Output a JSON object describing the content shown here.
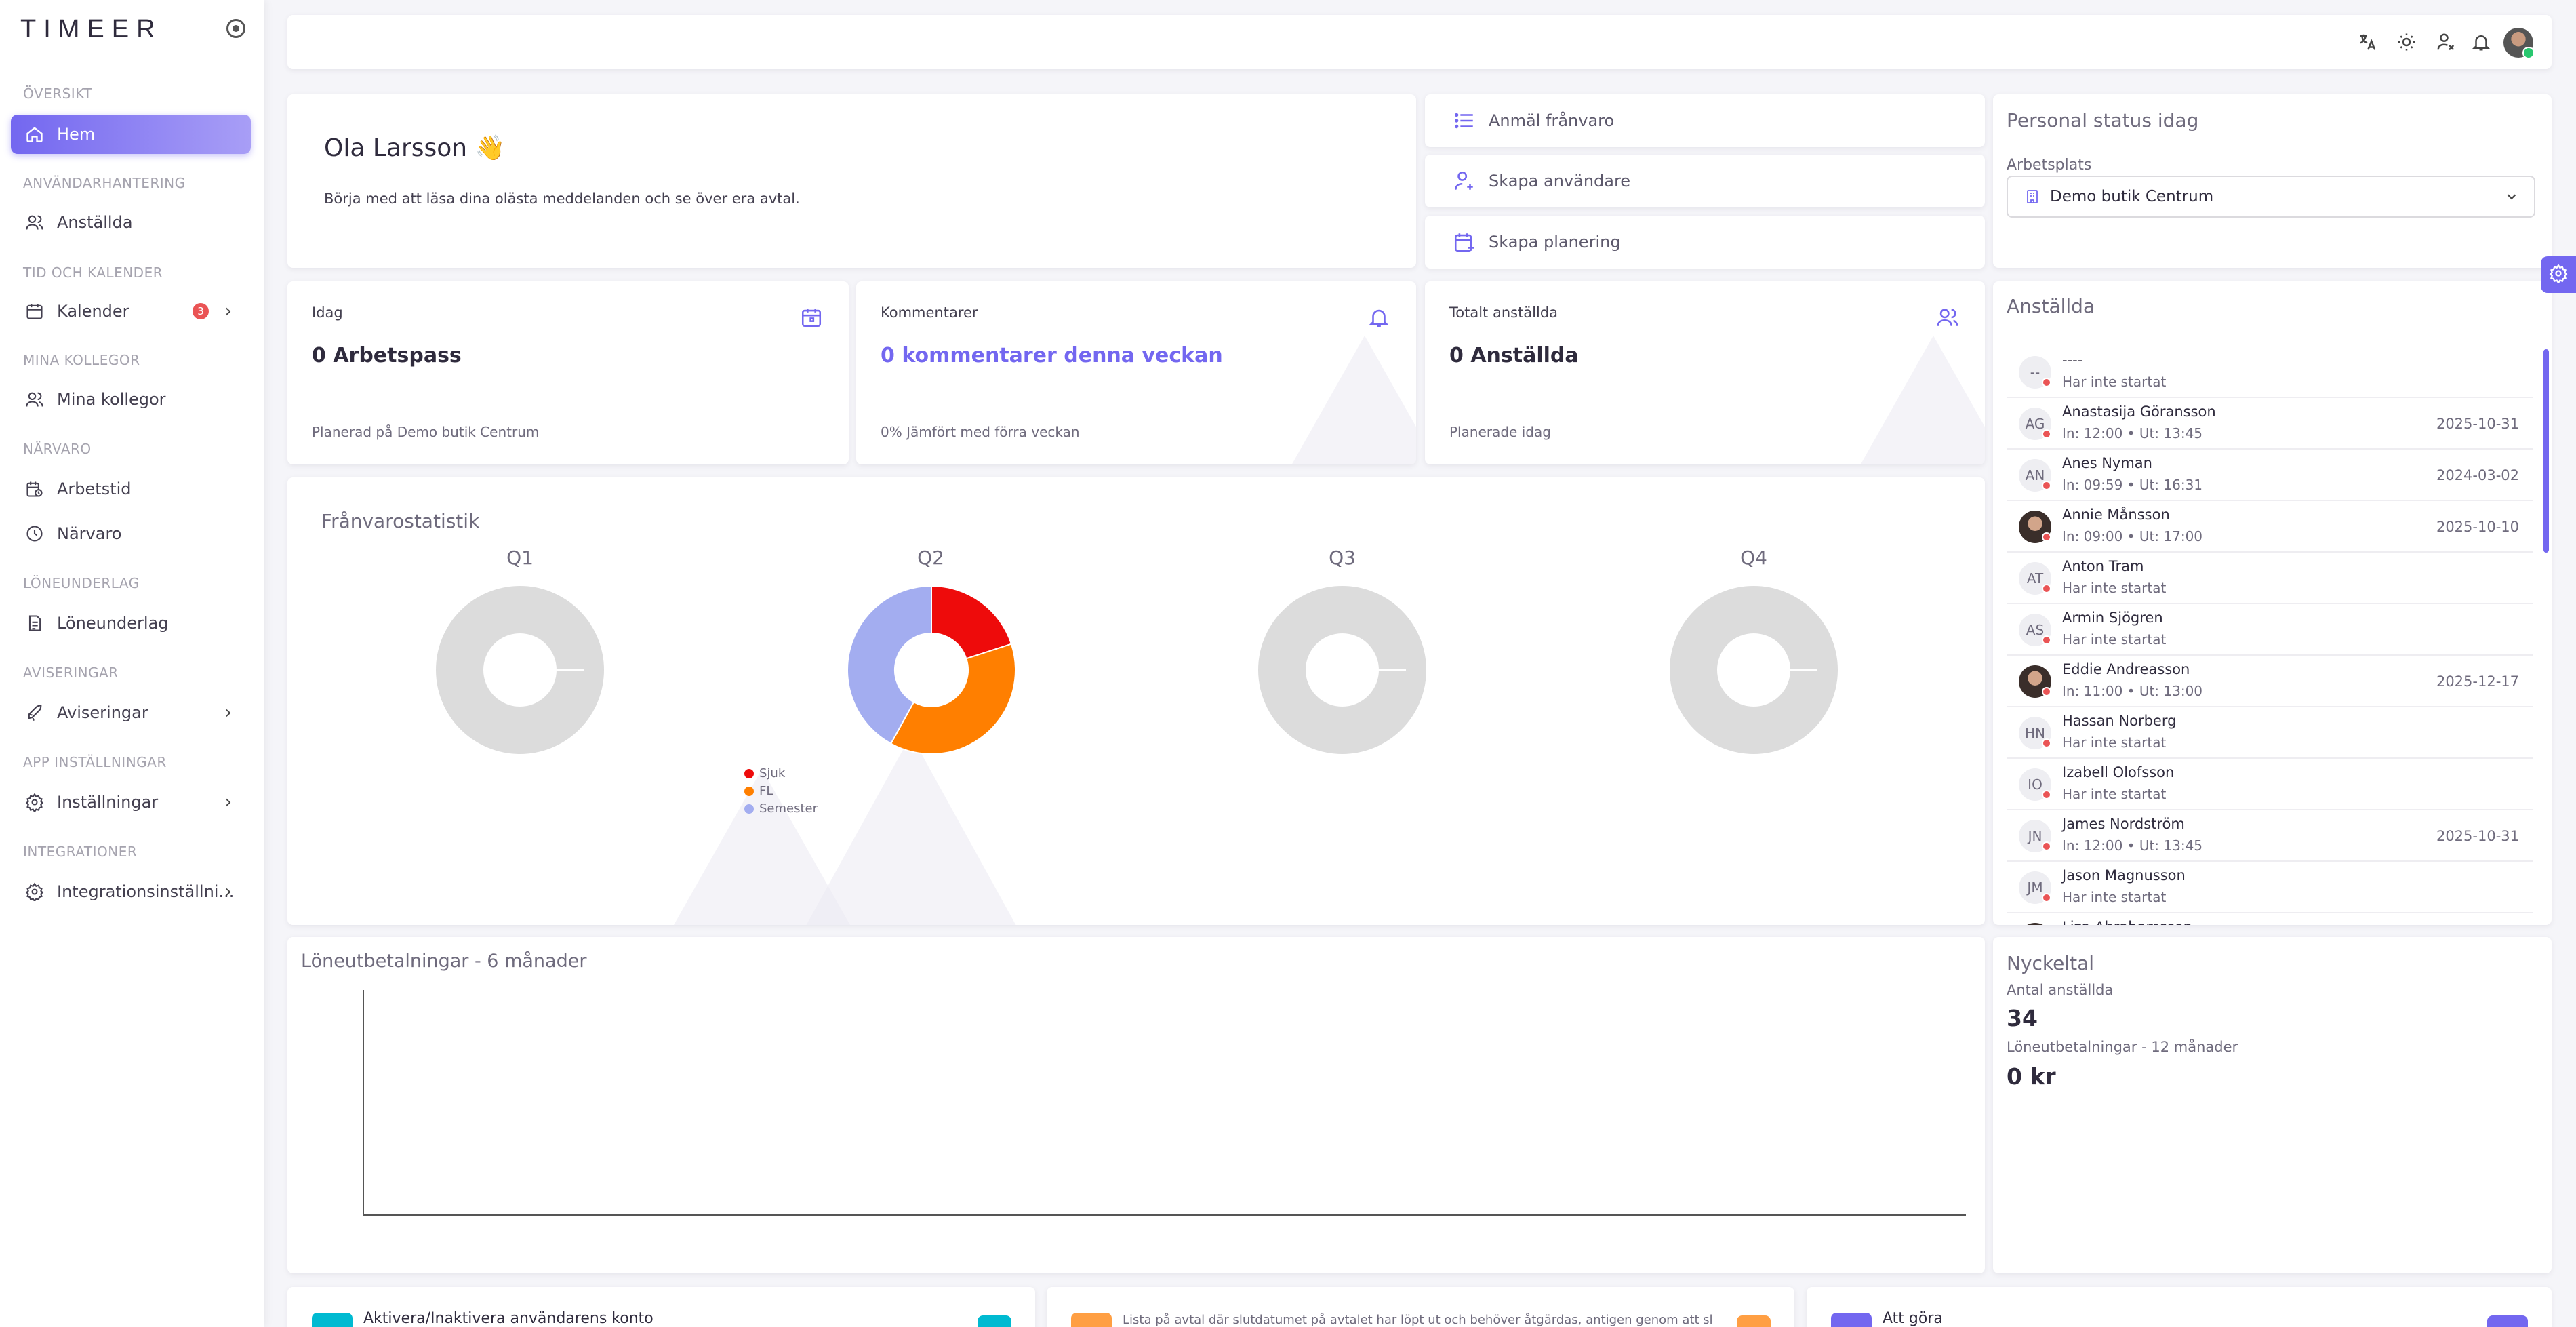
{
  "sidebar": {
    "logo": "TIMEER",
    "sections": {
      "overview": "Översikt",
      "user_mgmt": "Användarhantering",
      "time_calendar": "Tid och kalender",
      "colleagues": "Mina kollegor",
      "attendance": "Närvaro",
      "payroll": "Löneunderlag",
      "notifications": "Aviseringar",
      "app_settings": "App inställningar",
      "integrations": "Integrationer"
    },
    "items": {
      "home": "Hem",
      "employees": "Anställda",
      "calendar": "Kalender",
      "calendar_badge": "3",
      "my_colleagues": "Mina kollegor",
      "worktime": "Arbetstid",
      "attendance": "Närvaro",
      "payroll": "Löneunderlag",
      "notifications": "Aviseringar",
      "settings": "Inställningar",
      "integration_settings": "Integrationsinställni..."
    }
  },
  "greeting": {
    "name": "Ola Larsson 👋",
    "subtitle": "Börja med att läsa dina olästa meddelanden och se över era avtal."
  },
  "actions": {
    "report_absence": "Anmäl frånvaro",
    "create_user": "Skapa användare",
    "create_schedule": "Skapa planering"
  },
  "staff_status": {
    "title": "Personal status idag",
    "workplace_label": "Arbetsplats",
    "workplace_value": "Demo butik Centrum"
  },
  "stats": {
    "today": {
      "label": "Idag",
      "value": "0 Arbetspass",
      "foot": "Planerad på Demo butik Centrum"
    },
    "comments": {
      "label": "Kommentarer",
      "value": "0 kommentarer denna veckan",
      "foot": "0% Jämfört med förra veckan"
    },
    "total": {
      "label": "Totalt anställda",
      "value": "0 Anställda",
      "foot": "Planerade idag"
    }
  },
  "absence": {
    "title": "Frånvarostatistik",
    "quarters": [
      "Q1",
      "Q2",
      "Q3",
      "Q4"
    ],
    "legend": [
      "Sjuk",
      "FL",
      "Semester"
    ]
  },
  "chart_data": [
    {
      "type": "pie",
      "title": "Q2",
      "categories": [
        "Sjuk",
        "FL",
        "Semester"
      ],
      "values": [
        20,
        38,
        42
      ],
      "colors": [
        "#ee0b0b",
        "#ff7f00",
        "#a3adf0"
      ]
    },
    {
      "type": "line",
      "title": "Löneutbetalningar - 6 månader",
      "x": [],
      "series": []
    }
  ],
  "employees": {
    "title": "Anställda",
    "rows": [
      {
        "initials": "--",
        "name": "----",
        "sub": "Har inte startat",
        "date": ""
      },
      {
        "initials": "AG",
        "name": "Anastasija Göransson",
        "sub": "In: 12:00 • Ut: 13:45",
        "date": "2025-10-31"
      },
      {
        "initials": "AN",
        "name": "Anes Nyman",
        "sub": "In: 09:59 • Ut: 16:31",
        "date": "2024-03-02"
      },
      {
        "initials": "",
        "name": "Annie Månsson",
        "sub": "In: 09:00 • Ut: 17:00",
        "date": "2025-10-10"
      },
      {
        "initials": "AT",
        "name": "Anton Tram",
        "sub": "Har inte startat",
        "date": ""
      },
      {
        "initials": "AS",
        "name": "Armin Sjögren",
        "sub": "Har inte startat",
        "date": ""
      },
      {
        "initials": "",
        "name": "Eddie Andreasson",
        "sub": "In: 11:00 • Ut: 13:00",
        "date": "2025-12-17"
      },
      {
        "initials": "HN",
        "name": "Hassan Norberg",
        "sub": "Har inte startat",
        "date": ""
      },
      {
        "initials": "IO",
        "name": "Izabell Olofsson",
        "sub": "Har inte startat",
        "date": ""
      },
      {
        "initials": "JN",
        "name": "James Nordström",
        "sub": "In: 12:00 • Ut: 13:45",
        "date": "2025-10-31"
      },
      {
        "initials": "JM",
        "name": "Jason Magnusson",
        "sub": "Har inte startat",
        "date": ""
      },
      {
        "initials": "",
        "name": "Liza Abrahamsson",
        "sub": "",
        "date": ""
      }
    ]
  },
  "payroll_chart": {
    "title": "Löneutbetalningar - 6 månader"
  },
  "key_figures": {
    "title": "Nyckeltal",
    "employees_label": "Antal anställda",
    "employees_value": "34",
    "payroll_label": "Löneutbetalningar - 12 månader",
    "payroll_value": "0 kr"
  },
  "bottom_cards": {
    "activate": "Aktivera/Inaktivera användarens konto",
    "contracts": "Lista på avtal där slutdatumet på avtalet har löpt ut och behöver åtgärdas, antigen genom att skapa",
    "todo": "Att göra"
  },
  "colors": {
    "accent": "#7367f0",
    "danger": "#ea5455",
    "success": "#28c76f"
  }
}
